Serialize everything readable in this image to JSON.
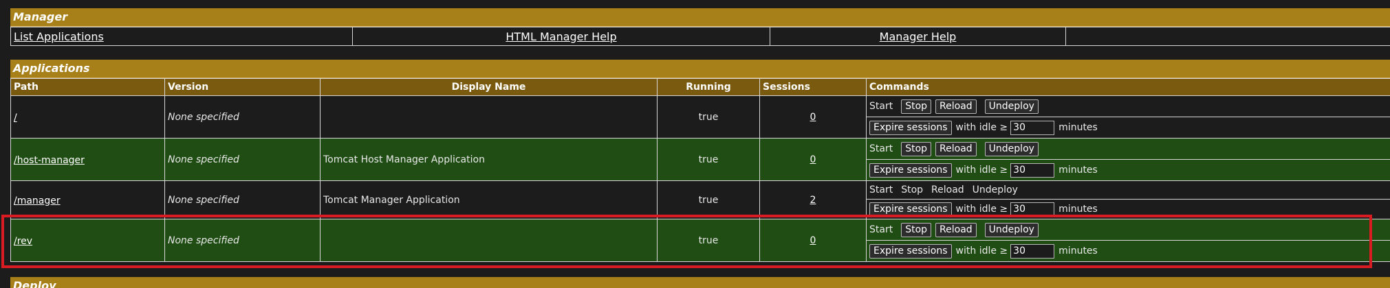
{
  "manager": {
    "title": "Manager",
    "nav": [
      "List Applications",
      "HTML Manager Help",
      "Manager Help"
    ]
  },
  "applications": {
    "title": "Applications",
    "columns": [
      "Path",
      "Version",
      "Display Name",
      "Running",
      "Sessions",
      "Commands"
    ],
    "rows": [
      {
        "path": "/",
        "version": "None specified",
        "display_name": "",
        "running": "true",
        "sessions": "0"
      },
      {
        "path": "/host-manager",
        "version": "None specified",
        "display_name": "Tomcat Host Manager Application",
        "running": "true",
        "sessions": "0"
      },
      {
        "path": "/manager",
        "version": "None specified",
        "display_name": "Tomcat Manager Application",
        "running": "true",
        "sessions": "2"
      },
      {
        "path": "/rev",
        "version": "None specified",
        "display_name": "",
        "running": "true",
        "sessions": "0"
      }
    ],
    "commands": {
      "start": "Start",
      "stop": "Stop",
      "reload": "Reload",
      "undeploy": "Undeploy",
      "expire": "Expire sessions",
      "with_idle": "with idle ≥",
      "idle_value": "30",
      "minutes": "minutes"
    }
  },
  "next_section": {
    "title": "Deploy"
  },
  "colors": {
    "header": "#a8801a",
    "column_header": "#7a5a0e",
    "green_row": "#1f4d13",
    "highlight": "#d91c22"
  }
}
